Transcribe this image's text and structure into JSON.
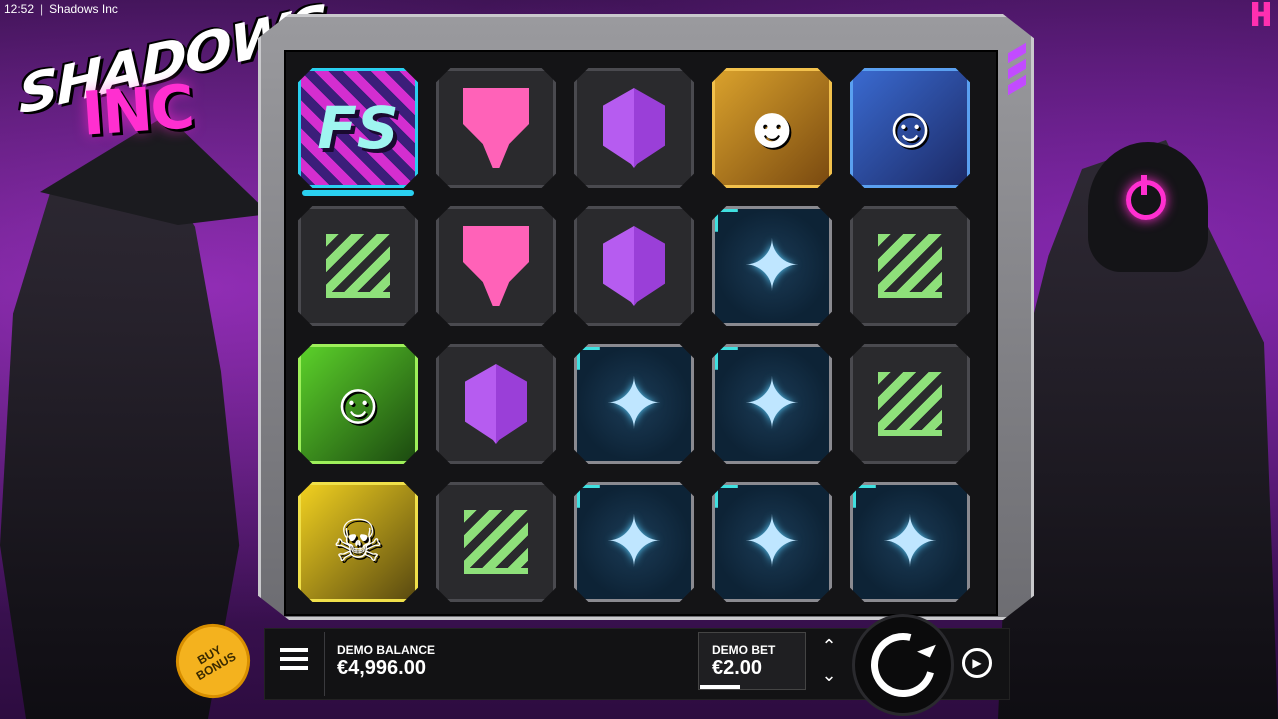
{
  "status_bar": {
    "time": "12:52",
    "separator": "|",
    "title": "Shadows Inc"
  },
  "logo": {
    "line1": "SHADOWS",
    "line2": "INC"
  },
  "reels": [
    [
      {
        "symbol": "fs",
        "label": "FS"
      },
      {
        "symbol": "pink-heart"
      },
      {
        "symbol": "purple-cube"
      },
      {
        "symbol": "oni-mask"
      },
      {
        "symbol": "blue-ninja"
      }
    ],
    [
      {
        "symbol": "green-stripes"
      },
      {
        "symbol": "pink-heart"
      },
      {
        "symbol": "purple-cube"
      },
      {
        "symbol": "shuriken"
      },
      {
        "symbol": "green-stripes"
      }
    ],
    [
      {
        "symbol": "green-ninja"
      },
      {
        "symbol": "purple-cube"
      },
      {
        "symbol": "shuriken"
      },
      {
        "symbol": "shuriken"
      },
      {
        "symbol": "green-stripes"
      }
    ],
    [
      {
        "symbol": "yellow-skull"
      },
      {
        "symbol": "green-stripes"
      },
      {
        "symbol": "shuriken"
      },
      {
        "symbol": "shuriken"
      },
      {
        "symbol": "shuriken"
      }
    ]
  ],
  "buy_bonus": {
    "label_line1": "BUY",
    "label_line2": "BONUS"
  },
  "balance": {
    "label": "DEMO BALANCE",
    "value": "€4,996.00"
  },
  "bet": {
    "label": "DEMO BET",
    "value": "€2.00"
  },
  "colors": {
    "accent": "#ff2fd0",
    "buy_bonus": "#f4b21e",
    "shuriken_frame": "#40e0e0"
  }
}
